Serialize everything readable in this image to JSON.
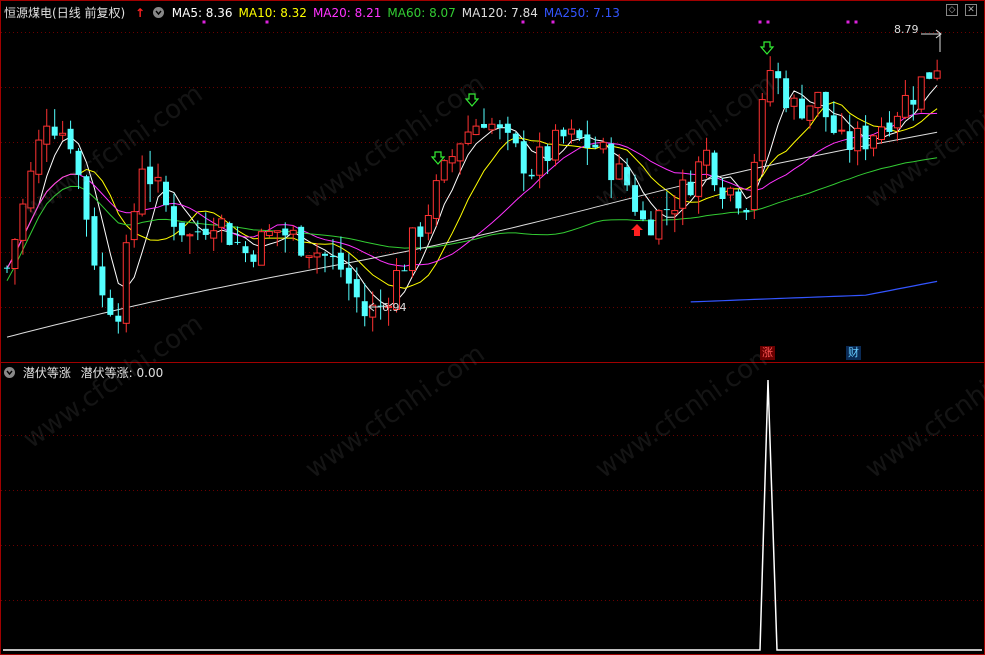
{
  "header": {
    "stock_name": "恒源煤电",
    "period": "(日线 前复权)",
    "ma": [
      {
        "label": "MA5: 8.36",
        "color": "#ffffff"
      },
      {
        "label": "MA10: 8.32",
        "color": "#ffff00"
      },
      {
        "label": "MA20: 8.21",
        "color": "#ff33ff"
      },
      {
        "label": "MA60: 8.07",
        "color": "#33cc33"
      },
      {
        "label": "MA120: 7.84",
        "color": "#dddddd"
      },
      {
        "label": "MA250: 7.13",
        "color": "#3355ff"
      }
    ]
  },
  "main_chart": {
    "high_label": "8.79",
    "low_label": "6.94",
    "badges": [
      {
        "text": "涨",
        "bg": "#6a0000",
        "fg": "#ff5555"
      },
      {
        "text": "财",
        "bg": "#0a2a55",
        "fg": "#66ccff"
      }
    ]
  },
  "indicator": {
    "name": "潜伏等涨",
    "value_label": "潜伏等涨: 0.00"
  },
  "watermark": "www.cfcnhi.com",
  "colors": {
    "up": "#ff3232",
    "down": "#54ffff",
    "grid": "#6a0000",
    "border": "#a00000",
    "ma5": "#ffffff",
    "ma10": "#ffff00",
    "ma20": "#ff33ff",
    "ma60": "#33cc33",
    "ma120": "#dddddd",
    "ma250": "#3355ff"
  }
}
